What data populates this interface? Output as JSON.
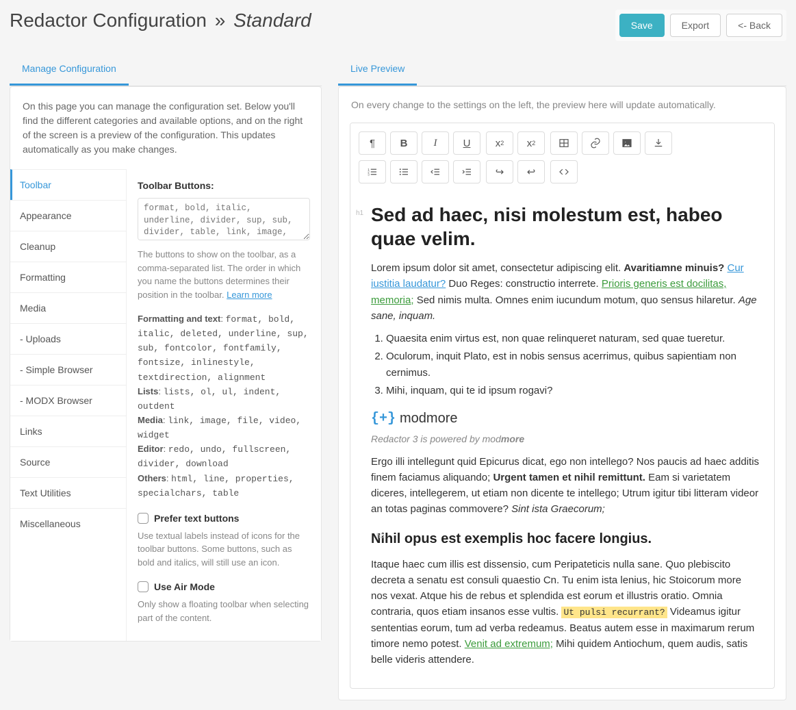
{
  "header": {
    "title_prefix": "Redactor Configuration",
    "title_sep": "»",
    "title_name": "Standard",
    "save_label": "Save",
    "export_label": "Export",
    "back_label": "<- Back"
  },
  "left": {
    "tab_label": "Manage Configuration",
    "description": "On this page you can manage the configuration set. Below you'll find the different categories and available options, and on the right of the screen is a preview of the configuration. This updates automatically as you make changes.",
    "sidebar": [
      "Toolbar",
      "Appearance",
      "Cleanup",
      "Formatting",
      "Media",
      "- Uploads",
      "- Simple Browser",
      "- MODX Browser",
      "Links",
      "Source",
      "Text Utilities",
      "Miscellaneous"
    ],
    "settings": {
      "heading": "Toolbar Buttons:",
      "value": "format, bold, italic, underline, divider, sup, sub, divider, table, link, image,",
      "help": "The buttons to show on the toolbar, as a comma-separated list. The order in which you name the buttons determines their position in the toolbar.",
      "learn_more": "Learn more",
      "groups": {
        "formatting_label": "Formatting and text",
        "formatting_items": "format, bold, italic, deleted, underline, sup, sub, fontcolor, fontfamily, fontsize, inlinestyle, textdirection, alignment",
        "lists_label": "Lists",
        "lists_items": "lists, ol, ul, indent, outdent",
        "media_label": "Media",
        "media_items": "link, image, file, video, widget",
        "editor_label": "Editor",
        "editor_items": "redo, undo, fullscreen, divider, download",
        "others_label": "Others",
        "others_items": "html, line, properties, specialchars, table"
      },
      "prefer_text_label": "Prefer text buttons",
      "prefer_text_help": "Use textual labels instead of icons for the toolbar buttons. Some buttons, such as bold and italics, will still use an icon.",
      "air_mode_label": "Use Air Mode",
      "air_mode_help": "Only show a floating toolbar when selecting part of the content."
    }
  },
  "right": {
    "tab_label": "Live Preview",
    "description": "On every change to the settings on the left, the preview here will update automatically.",
    "toolbar_icons": {
      "format": "¶",
      "bold": "B",
      "italic": "I",
      "underline": "U",
      "sup": "x",
      "sub": "x",
      "redo": "↪",
      "undo": "↩"
    },
    "content": {
      "h1": "Sed ad haec, nisi molestum est, habeo quae velim.",
      "p1_a": "Lorem ipsum dolor sit amet, consectetur adipiscing elit. ",
      "p1_b": "Avaritiamne minuis?",
      "p1_link1": "Cur iustitia laudatur?",
      "p1_c": " Duo Reges: constructio interrete. ",
      "p1_link2": "Prioris generis est docilitas, memoria;",
      "p1_d": " Sed nimis multa. Omnes enim iucundum motum, quo sensus hilaretur. ",
      "p1_em": "Age sane, inquam.",
      "ol": [
        "Quaesita enim virtus est, non quae relinqueret naturam, sed quae tueretur.",
        "Oculorum, inquit Plato, est in nobis sensus acerrimus, quibus sapientiam non cernimus.",
        "Mihi, inquam, qui te id ipsum rogavi?"
      ],
      "logo_pre": "{+}",
      "logo_text": "modmore",
      "logo_cap_a": "Redactor 3 is powered by mod",
      "logo_cap_b": "more",
      "p2_a": "Ergo illi intellegunt quid Epicurus dicat, ego non intellego? Nos paucis ad haec additis finem faciamus aliquando; ",
      "p2_b": "Urgent tamen et nihil remittunt.",
      "p2_c": " Eam si varietatem diceres, intellegerem, ut etiam non dicente te intellego; Utrum igitur tibi litteram videor an totas paginas commovere? ",
      "p2_em": "Sint ista Graecorum;",
      "h3": "Nihil opus est exemplis hoc facere longius.",
      "p3_a": "Itaque haec cum illis est dissensio, cum Peripateticis nulla sane. Quo plebiscito decreta a senatu est consuli quaestio Cn. Tu enim ista lenius, hic Stoicorum more nos vexat. Atque his de rebus et splendida est eorum et illustris oratio. Omnia contraria, quos etiam insanos esse vultis. ",
      "p3_hl": "Ut pulsi recurrant?",
      "p3_b": " Videamus igitur sententias eorum, tum ad verba redeamus. Beatus autem esse in maximarum rerum timore nemo potest. ",
      "p3_link": "Venit ad extremum;",
      "p3_c": " Mihi quidem Antiochum, quem audis, satis belle videris attendere."
    }
  }
}
